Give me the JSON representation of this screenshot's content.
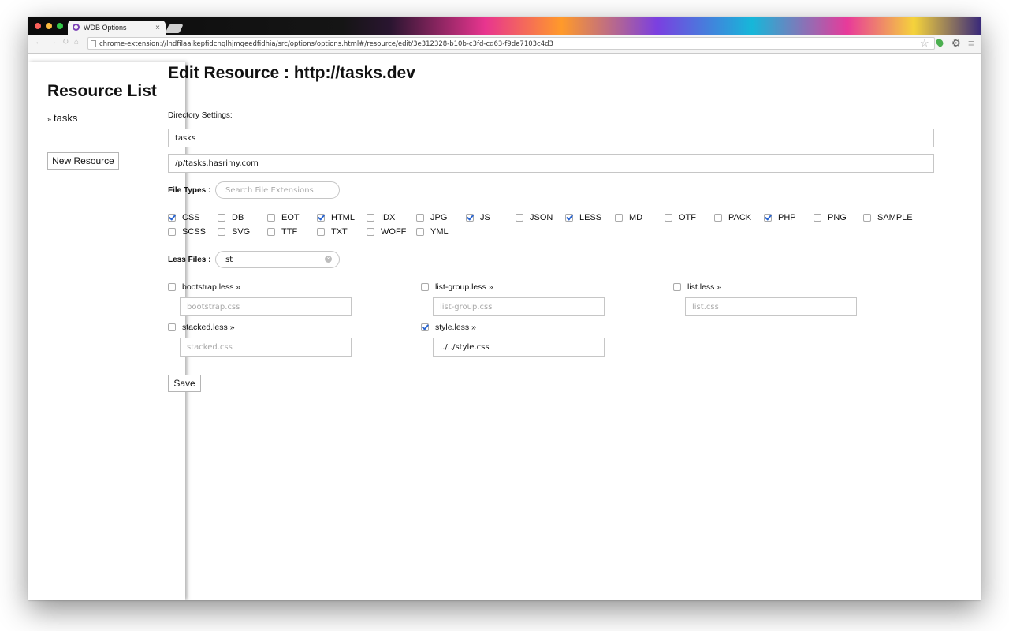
{
  "browser": {
    "tab_title": "WDB Options",
    "tab_close": "×",
    "url": "chrome-extension://lndfilaaikepfidcnglhjmgeedfidhia/src/options/options.html#/resource/edit/3e312328-b10b-c3fd-cd63-f9de7103c4d3"
  },
  "sidebar": {
    "title": "Resource List",
    "items": [
      {
        "label": "tasks",
        "prefix": "»"
      }
    ],
    "new_resource_button": "New Resource"
  },
  "main": {
    "title": "Edit Resource : http://tasks.dev",
    "directory_settings_label": "Directory Settings:",
    "directory_name_value": "tasks",
    "directory_path_value": "/p/tasks.hasrimy.com",
    "file_types_label": "File Types :",
    "file_types_search_placeholder": "Search File Extensions",
    "file_types": [
      {
        "label": "CSS",
        "checked": true
      },
      {
        "label": "DB",
        "checked": false
      },
      {
        "label": "EOT",
        "checked": false
      },
      {
        "label": "HTML",
        "checked": true
      },
      {
        "label": "IDX",
        "checked": false
      },
      {
        "label": "JPG",
        "checked": false
      },
      {
        "label": "JS",
        "checked": true
      },
      {
        "label": "JSON",
        "checked": false
      },
      {
        "label": "LESS",
        "checked": true
      },
      {
        "label": "MD",
        "checked": false
      },
      {
        "label": "OTF",
        "checked": false
      },
      {
        "label": "PACK",
        "checked": false
      },
      {
        "label": "PHP",
        "checked": true
      },
      {
        "label": "PNG",
        "checked": false
      },
      {
        "label": "SAMPLE",
        "checked": false
      },
      {
        "label": "SCSS",
        "checked": false
      },
      {
        "label": "SVG",
        "checked": false
      },
      {
        "label": "TTF",
        "checked": false
      },
      {
        "label": "TXT",
        "checked": false
      },
      {
        "label": "WOFF",
        "checked": false
      },
      {
        "label": "YML",
        "checked": false
      }
    ],
    "less_files_label": "Less Files :",
    "less_files_search_value": "st",
    "less_files": [
      {
        "label": "bootstrap.less »",
        "checked": false,
        "output_value": "",
        "output_placeholder": "bootstrap.css"
      },
      {
        "label": "list-group.less »",
        "checked": false,
        "output_value": "",
        "output_placeholder": "list-group.css"
      },
      {
        "label": "list.less »",
        "checked": false,
        "output_value": "",
        "output_placeholder": "list.css"
      },
      {
        "label": "stacked.less »",
        "checked": false,
        "output_value": "",
        "output_placeholder": "stacked.css"
      },
      {
        "label": "style.less »",
        "checked": true,
        "output_value": "../../style.css",
        "output_placeholder": ""
      }
    ],
    "save_button": "Save"
  },
  "icons": {
    "star": "star-icon",
    "extension": "leaf-icon",
    "settings": "gear-icon",
    "menu": "menu-icon"
  },
  "colors": {
    "checkbox_accent": "#2b66d1",
    "extension_icon": "#4caf50"
  }
}
